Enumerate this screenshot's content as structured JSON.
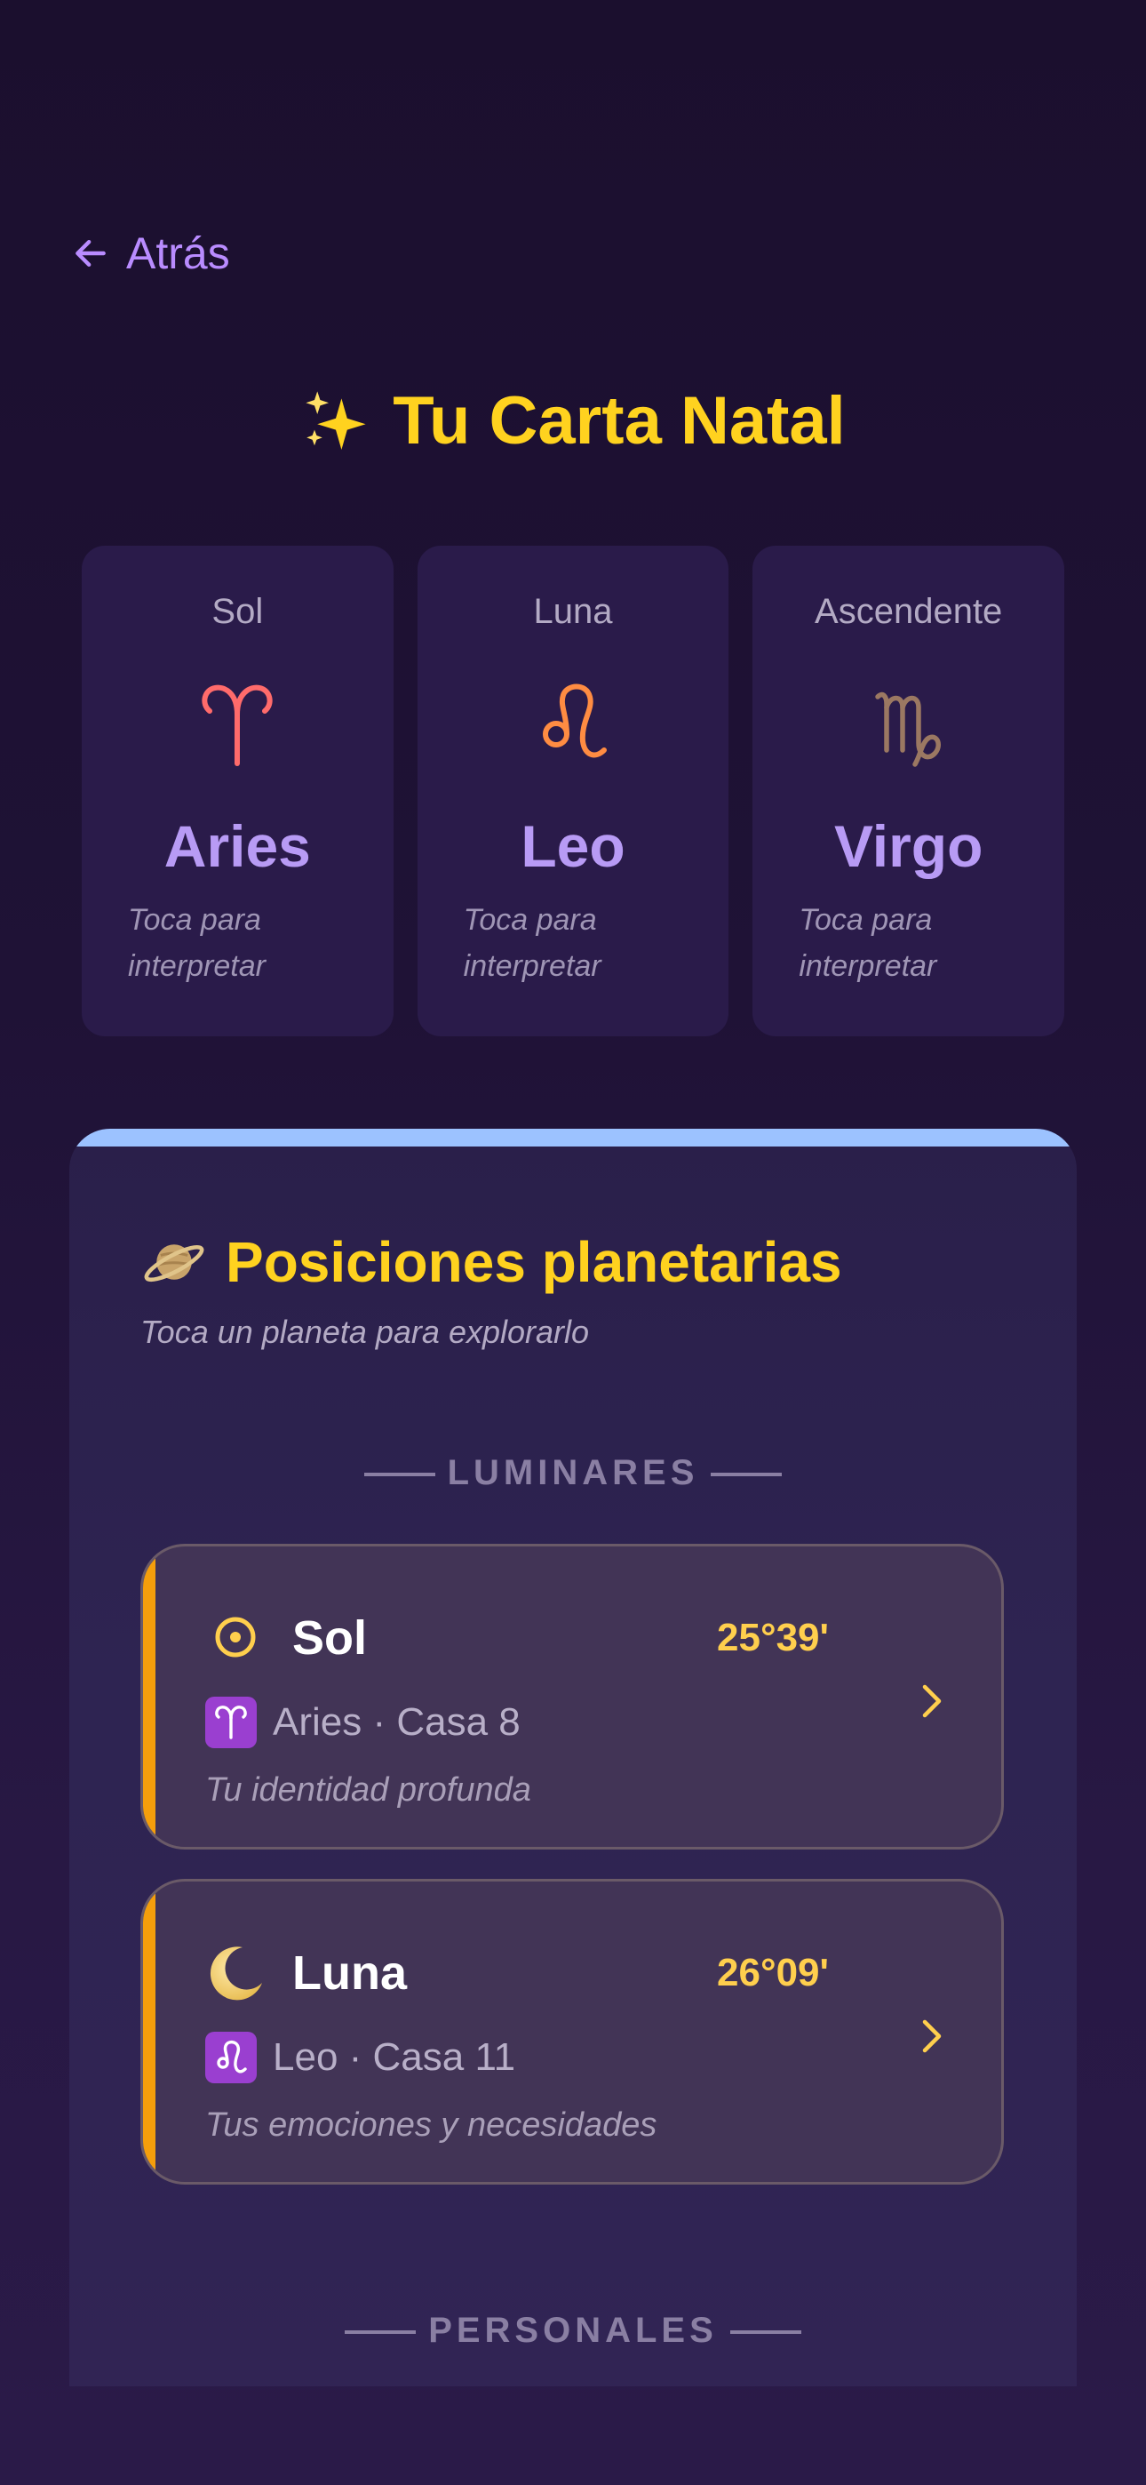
{
  "nav": {
    "back_label": "Atrás"
  },
  "header": {
    "title": "Tu Carta Natal",
    "title_icon": "sparkles-icon"
  },
  "big_three": [
    {
      "label": "Sol",
      "symbol": "aries-symbol",
      "sign": "Aries",
      "hint": "Toca para interpretar",
      "color": "#ff6b6b"
    },
    {
      "label": "Luna",
      "symbol": "leo-symbol",
      "sign": "Leo",
      "hint": "Toca para interpretar",
      "color": "#ff8c42"
    },
    {
      "label": "Ascendente",
      "symbol": "virgo-symbol",
      "sign": "Virgo",
      "hint": "Toca para interpretar",
      "color": "#9b7862"
    }
  ],
  "planets_panel": {
    "title": "Posiciones planetarias",
    "title_icon": "saturn-icon",
    "subtitle": "Toca un planeta para explorarlo",
    "sections": [
      {
        "title": "LUMINARES",
        "items": [
          {
            "name": "Sol",
            "icon": "sun-icon",
            "degree": "25°39'",
            "sign_icon": "aries-badge",
            "sign_line": "Aries · Casa 8",
            "description": "Tu identidad profunda"
          },
          {
            "name": "Luna",
            "icon": "crescent-moon-icon",
            "degree": "26°09'",
            "sign_icon": "leo-badge",
            "sign_line": "Leo · Casa 11",
            "description": "Tus emociones y necesidades"
          }
        ]
      },
      {
        "title": "PERSONALES",
        "items": []
      }
    ]
  },
  "colors": {
    "accent_gold": "#ffd21f",
    "accent_purple": "#b98cff",
    "row_accent": "#f59e0b",
    "panel_top_bar": "#9cc2ff"
  }
}
